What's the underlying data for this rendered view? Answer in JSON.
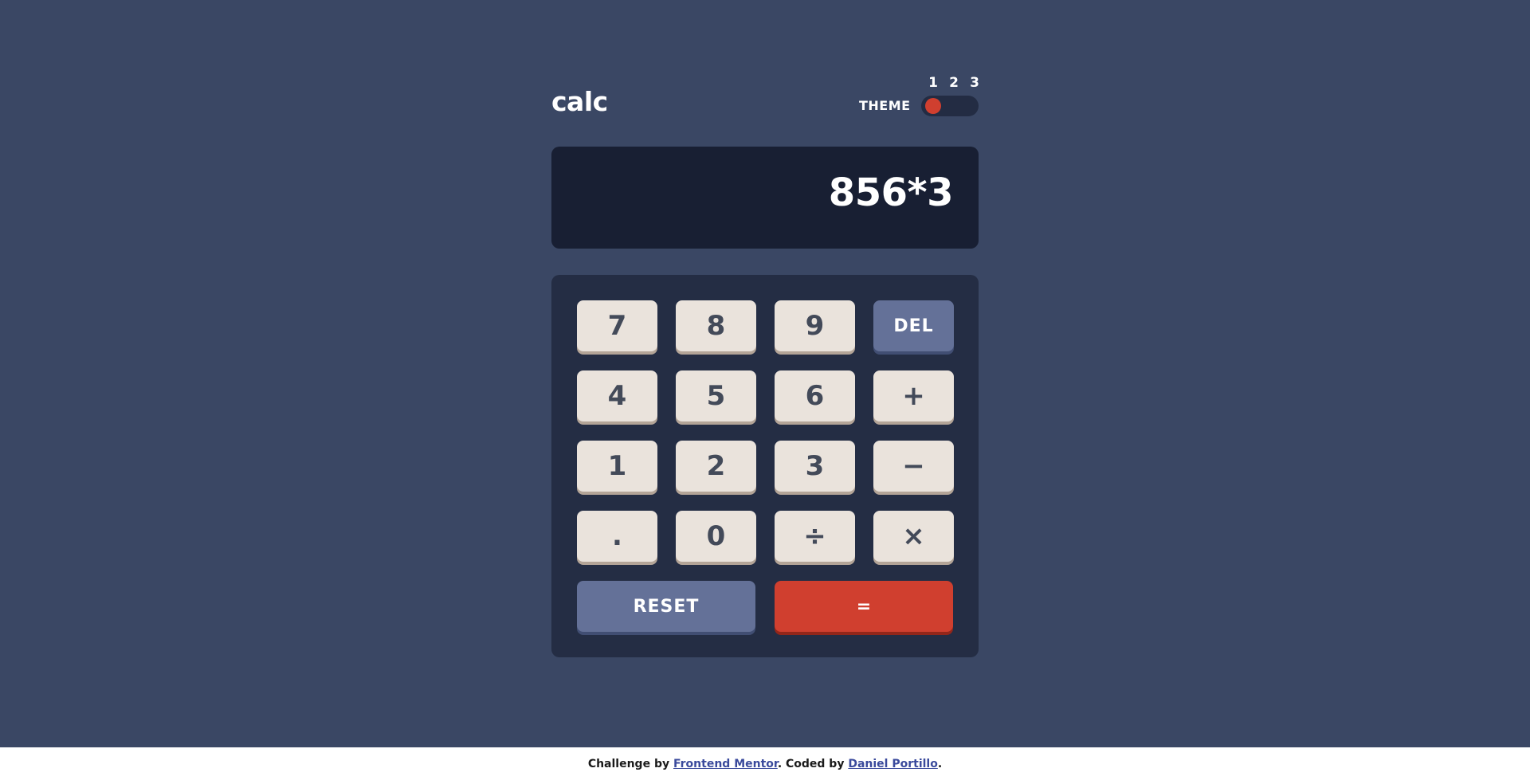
{
  "header": {
    "logo": "calc",
    "theme_label": "THEME",
    "theme_options": [
      "1",
      "2",
      "3"
    ],
    "active_theme": "1"
  },
  "display": {
    "value": "856*3"
  },
  "keys": {
    "row1": [
      "7",
      "8",
      "9",
      "DEL"
    ],
    "row2": [
      "4",
      "5",
      "6",
      "+"
    ],
    "row3": [
      "1",
      "2",
      "3",
      "−"
    ],
    "row4": [
      ".",
      "0",
      "÷",
      "×"
    ],
    "reset": "RESET",
    "equals": "="
  },
  "footer": {
    "prefix": "Challenge by ",
    "link1": "Frontend Mentor",
    "middle": ". Coded by ",
    "link2": "Daniel Portillo",
    "suffix": "."
  },
  "colors": {
    "background": "#3a4764",
    "keypad": "#242d44",
    "screen": "#181f33",
    "key": "#eae3dc",
    "accent_blue": "#647198",
    "accent_red": "#d03f2f"
  }
}
